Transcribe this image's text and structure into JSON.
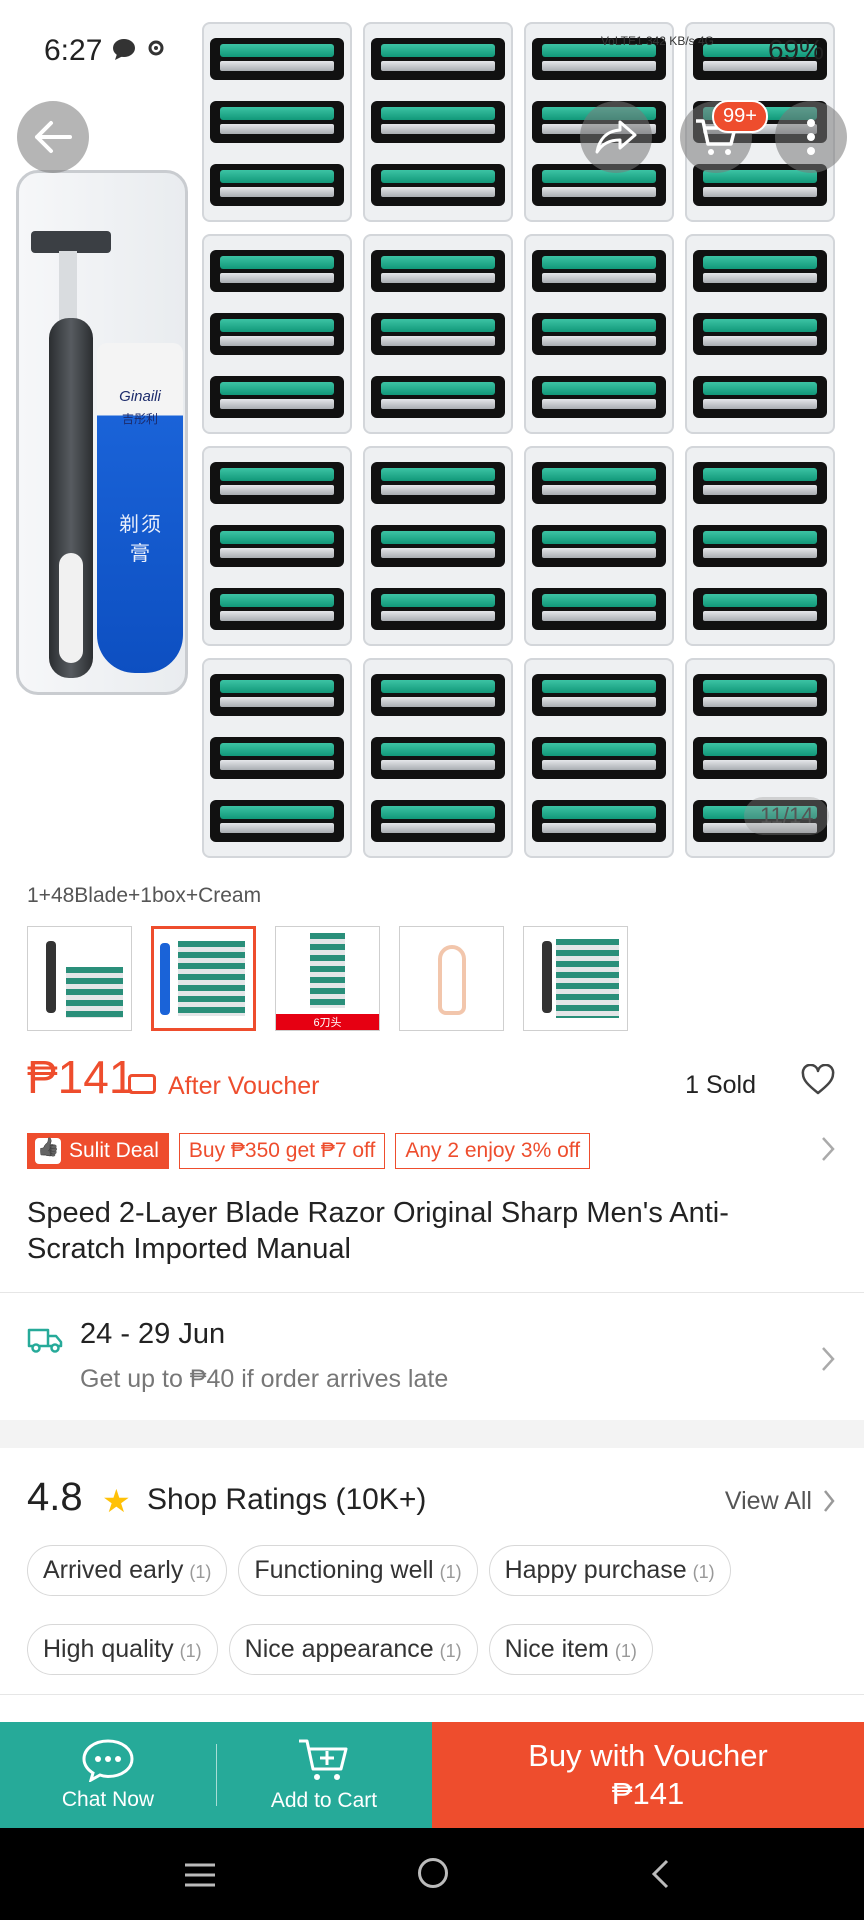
{
  "status_bar": {
    "time": "6:27",
    "notification_icons": [
      "chat-bubble-icon",
      "settings-icon"
    ],
    "network_text": "VoLTE1 342 KB/s 4G",
    "signal_label": "4G",
    "battery": "69%"
  },
  "gallery": {
    "kit_brand": "Ginaili",
    "kit_brand_cn": "吉彤利",
    "kit_tube_text": "剃须膏",
    "counter": "11/14",
    "cart_badge": "99+"
  },
  "variation": {
    "label": "1+48Blade+1box+Cream",
    "selected_index": 1,
    "thumb3_strip": "6刀头"
  },
  "product": {
    "price": "₱141",
    "after_voucher": "After Voucher",
    "sold": "1 Sold",
    "title": "Speed 2-Layer Blade Razor Original Sharp Men's Anti-Scratch Imported Manual"
  },
  "promotions": {
    "sulit_label": "Sulit Deal",
    "tags": [
      "Buy ₱350 get ₱7 off",
      "Any 2 enjoy 3% off"
    ]
  },
  "delivery": {
    "date_range": "24 - 29 Jun",
    "note": "Get up to ₱40 if order arrives late"
  },
  "ratings": {
    "score": "4.8",
    "label": "Shop Ratings (10K+)",
    "view_all": "View All",
    "chips": [
      {
        "label": "Arrived early",
        "count": "(1)"
      },
      {
        "label": "Functioning well",
        "count": "(1)"
      },
      {
        "label": "Happy purchase",
        "count": "(1)"
      },
      {
        "label": "High quality",
        "count": "(1)"
      },
      {
        "label": "Nice appearance",
        "count": "(1)"
      },
      {
        "label": "Nice item",
        "count": "(1)"
      }
    ]
  },
  "actions": {
    "chat": "Chat Now",
    "add_to_cart": "Add to Cart",
    "buy_line1": "Buy with Voucher",
    "buy_line2": "₱141"
  },
  "colors": {
    "brand_orange": "#ee4d2d",
    "teal": "#26aa99",
    "star": "#ffc107"
  }
}
